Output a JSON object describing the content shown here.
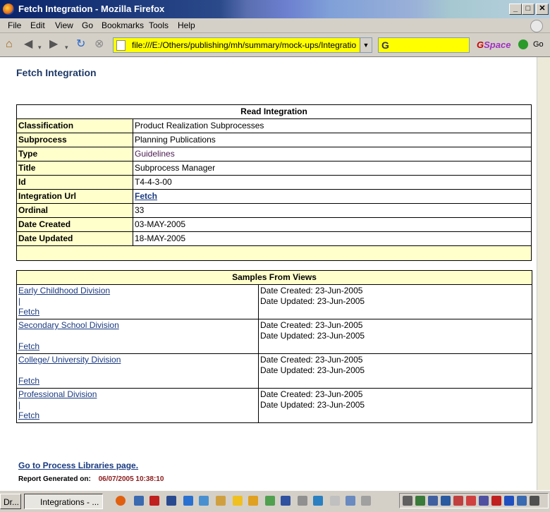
{
  "window": {
    "title": "Fetch Integration - Mozilla Firefox",
    "min": "_",
    "max": "□",
    "close": "✕"
  },
  "menu": [
    "File",
    "Edit",
    "View",
    "Go",
    "Bookmarks",
    "Tools",
    "Help"
  ],
  "toolbar": {
    "url": "file:///E:/Others/publishing/mh/summary/mock-ups/Integrations.htm",
    "gspace": "GSpace",
    "go": "Go"
  },
  "page": {
    "title": "Fetch Integration",
    "read_header": "Read Integration",
    "rows": [
      {
        "label": "Classification",
        "value": "Product Realization Subprocesses"
      },
      {
        "label": "Subprocess",
        "value": "Planning Publications"
      },
      {
        "label": "Type",
        "value": "Guidelines"
      },
      {
        "label": "Title",
        "value": "Subprocess Manager"
      },
      {
        "label": "Id",
        "value": "T4-4-3-00"
      },
      {
        "label": "Integration Url",
        "value": "Fetch"
      },
      {
        "label": "Ordinal",
        "value": "33"
      },
      {
        "label": "Date Created",
        "value": "03-MAY-2005"
      },
      {
        "label": "Date Updated",
        "value": "18-MAY-2005"
      }
    ],
    "samples_header": "Samples From Views",
    "samples": [
      {
        "division": "Early Childhood Division",
        "sep": "|",
        "fetch": "Fetch",
        "created": "Date Created: 23-Jun-2005",
        "updated": "Date Updated: 23-Jun-2005"
      },
      {
        "division": "Secondary School Division",
        "sep": "",
        "fetch": "Fetch",
        "created": "Date Created: 23-Jun-2005",
        "updated": "Date Updated: 23-Jun-2005"
      },
      {
        "division": "College/ University Division",
        "sep": "",
        "fetch": "Fetch",
        "created": "Date Created: 23-Jun-2005",
        "updated": "Date Updated: 23-Jun-2005"
      },
      {
        "division": "Professional Division",
        "sep": "|",
        "fetch": "Fetch",
        "created": "Date Created: 23-Jun-2005",
        "updated": "Date Updated: 23-Jun-2005"
      }
    ],
    "back_link": "Go to Process Libraries page.",
    "report_label": "Report Generated on:",
    "report_value": "06/07/2005 10:38:10"
  },
  "taskbar": {
    "task1": "Dr...",
    "task2": "Integrations - ..."
  }
}
